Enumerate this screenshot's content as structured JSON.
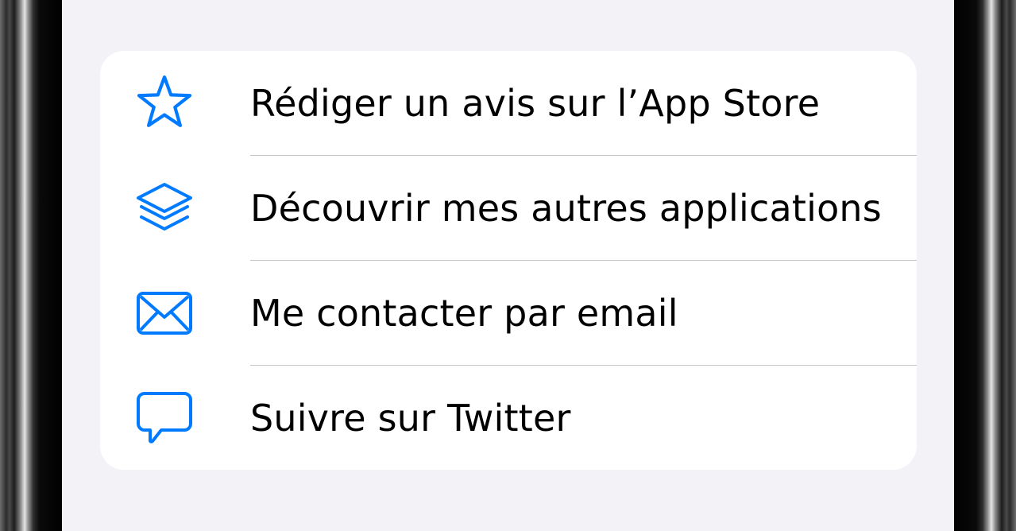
{
  "colors": {
    "accent": "#007aff",
    "background": "#f2f2f7",
    "card": "#ffffff",
    "separator": "#c6c6c8",
    "text": "#000000"
  },
  "menu": {
    "items": [
      {
        "icon": "star-icon",
        "label": "Rédiger un avis sur l’App Store"
      },
      {
        "icon": "layers-icon",
        "label": "Découvrir mes autres applications"
      },
      {
        "icon": "envelope-icon",
        "label": "Me contacter par email"
      },
      {
        "icon": "speech-bubble-icon",
        "label": "Suivre sur Twitter"
      }
    ]
  }
}
